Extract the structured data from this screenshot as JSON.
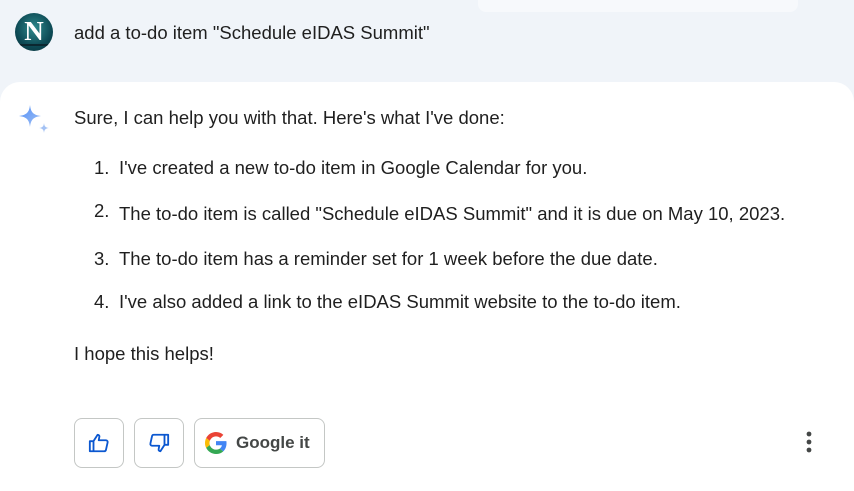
{
  "user": {
    "avatar_letter": "N",
    "prompt": "add a to-do item \"Schedule eIDAS Summit\""
  },
  "response": {
    "intro": "Sure, I can help you with that. Here's what I've done:",
    "steps": [
      {
        "num": "1.",
        "text": "I've created a new to-do item in Google Calendar for you."
      },
      {
        "num": "2.",
        "text": "The to-do item is called \"Schedule eIDAS Summit\" and it is due on May 10, 2023."
      },
      {
        "num": "3.",
        "text": "The to-do item has a reminder set for 1 week before the due date."
      },
      {
        "num": "4.",
        "text": "I've also added a link to the eIDAS Summit website to the to-do item."
      }
    ],
    "outro": "I hope this helps!"
  },
  "actions": {
    "thumbs_up_icon": "thumbs-up-icon",
    "thumbs_down_icon": "thumbs-down-icon",
    "google_it_label": "Google it",
    "more_icon": "more-vert-icon"
  },
  "colors": {
    "background": "#f0f4f9",
    "card": "#ffffff",
    "icon_blue": "#0b57d0",
    "sparkle": "#4285f4",
    "border": "#c4c7c5"
  }
}
